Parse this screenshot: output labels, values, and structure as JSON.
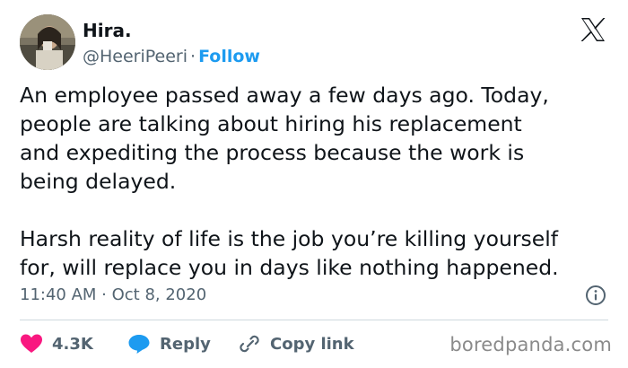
{
  "user": {
    "display_name": "Hira.",
    "handle": "@HeeriPeeri",
    "separator": "·",
    "follow_label": "Follow"
  },
  "tweet": {
    "text": "An employee passed away a few days ago. Today,\npeople are talking about hiring his replacement\nand expediting the process because the work is\nbeing delayed.\n\nHarsh reality of life is the job you’re killing yourself\nfor, will replace you in days like nothing happened.",
    "timestamp": "11:40 AM · Oct 8, 2020"
  },
  "actions": {
    "like_count": "4.3K",
    "reply_label": "Reply",
    "copy_link_label": "Copy link"
  },
  "watermark": "boredpanda.com",
  "icons": [
    "x-logo-icon",
    "info-icon",
    "heart-icon",
    "reply-bubble-icon",
    "link-icon"
  ],
  "colors": {
    "text": "#0f1419",
    "secondary": "#536471",
    "accent": "#1d9bf0",
    "like": "#f91880",
    "divider": "#cfd9de"
  }
}
